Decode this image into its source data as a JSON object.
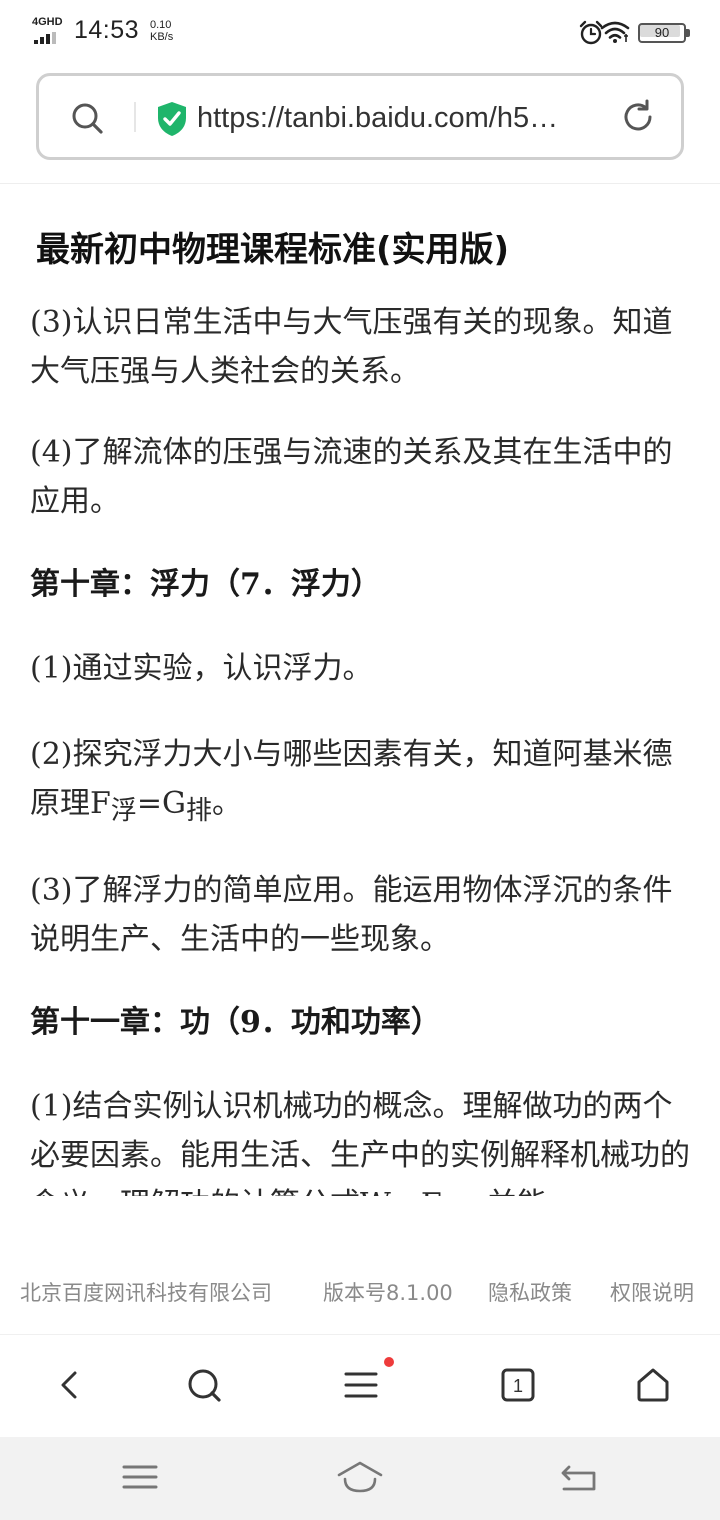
{
  "status_bar": {
    "network": "4GHD",
    "time": "14:53",
    "speed_value": "0.10",
    "speed_unit": "KB/s",
    "battery": "90",
    "icons": [
      "signal-icon",
      "alarm-icon",
      "wifi-icon",
      "battery-icon"
    ]
  },
  "address_bar": {
    "url": "https://tanbi.baidu.com/h5…",
    "icons": [
      "search-icon",
      "secure-shield-icon",
      "reload-icon"
    ],
    "secure_color": "#1fb56b"
  },
  "article": {
    "title": "最新初中物理课程标准(实用版)",
    "paragraphs": [
      {
        "text": "(3)认识日常生活中与大气压强有关的现象。知道大气压强与人类社会的关系。"
      },
      {
        "text": "(4)了解流体的压强与流速的关系及其在生活中的应用。"
      },
      {
        "text": "第十章：浮力（7．浮力）"
      },
      {
        "text": "(1)通过实验，认识浮力。"
      },
      {
        "prefix": "(2)探究浮力大小与哪些因素有关，知道阿基米德原理F",
        "sub1": "浮",
        "mid": "=G",
        "sub2": "排",
        "suffix": "。"
      },
      {
        "text": "(3)了解浮力的简单应用。能运用物体浮沉的条件说明生产、生活中的一些现象。"
      },
      {
        "text": "第十一章：功（9．功和功率）"
      },
      {
        "text": "(1)结合实例认识机械功的概念。理解做功的两个必要因素。能用生活、生产中的实例解释机械功的含义。理解功的计算公式W＝Fs，并能"
      }
    ]
  },
  "footer": {
    "company": "北京百度网讯科技有限公司",
    "version": "版本号8.1.00",
    "privacy": "隐私政策",
    "permissions": "权限说明"
  },
  "toolbar": {
    "icons": [
      "back-icon",
      "search-icon",
      "menu-icon",
      "tabs-icon",
      "home-icon"
    ],
    "tab_count": "1",
    "notification_color": "#ee3b3b"
  },
  "system_nav": {
    "icons": [
      "recent-apps-icon",
      "home-icon",
      "back-icon"
    ]
  }
}
